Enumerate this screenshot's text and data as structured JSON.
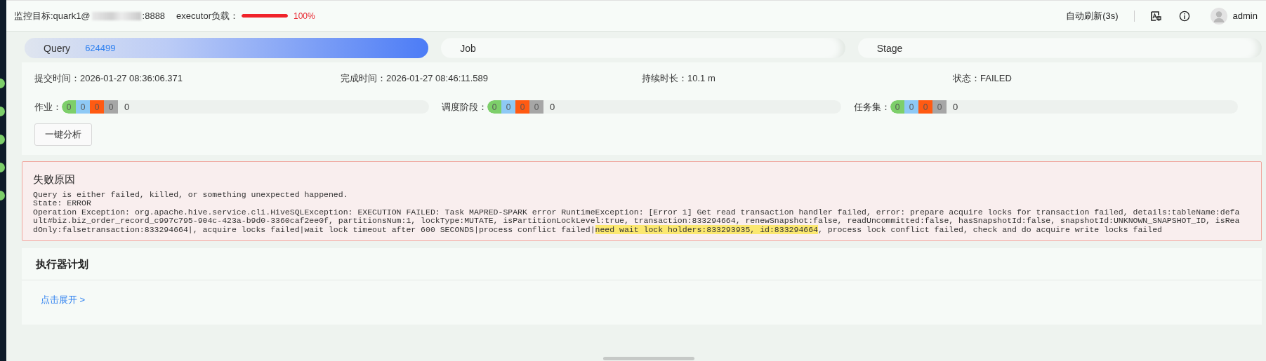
{
  "header": {
    "target_label": "监控目标:quark1@",
    "target_port": ":8888",
    "load_label": "executor负载：",
    "load": {
      "level": 1.0,
      "reading": "100%"
    },
    "refresh": "自动刷新(3s)",
    "user": "admin"
  },
  "tabs": [
    {
      "label": "Query",
      "count": "624499",
      "selected": true
    },
    {
      "label": "Job",
      "selected": false
    },
    {
      "label": "Stage",
      "selected": false
    }
  ],
  "summary": {
    "fields": [
      {
        "label": "提交时间：",
        "value": "2026-01-27 08:36:06.371"
      },
      {
        "label": "完成时间：",
        "value": "2026-01-27 08:46:11.589"
      },
      {
        "label": "持续时长：",
        "value": "10.1 m"
      },
      {
        "label": "状态：",
        "value": "FAILED"
      }
    ],
    "counters": [
      {
        "label": "作业：",
        "segments": [
          {
            "value": "0",
            "color": "#7dcf6a"
          },
          {
            "value": "0",
            "color": "#8ec9f5"
          },
          {
            "value": "0",
            "color": "#ff5a12"
          },
          {
            "value": "0",
            "color": "#a6a6a6"
          }
        ],
        "total": "0"
      },
      {
        "label": "调度阶段：",
        "segments": [
          {
            "value": "0",
            "color": "#7dcf6a"
          },
          {
            "value": "0",
            "color": "#8ec9f5"
          },
          {
            "value": "0",
            "color": "#ff5a12"
          },
          {
            "value": "0",
            "color": "#a6a6a6"
          }
        ],
        "total": "0"
      },
      {
        "label": "任务集：",
        "segments": [
          {
            "value": "0",
            "color": "#7dcf6a"
          },
          {
            "value": "0",
            "color": "#8ec9f5"
          },
          {
            "value": "0",
            "color": "#ff5a12"
          },
          {
            "value": "0",
            "color": "#a6a6a6"
          }
        ],
        "total": "0"
      }
    ],
    "analyze_button": "一键分析"
  },
  "failure": {
    "title": "失败原因",
    "lines": [
      "Query is either failed, killed, or something unexpected happened.",
      "State: ERROR"
    ],
    "detail_before": "Operation Exception: org.apache.hive.service.cli.HiveSQLException: EXECUTION FAILED: Task MAPRED-SPARK error RuntimeException: [Error 1] Get read transaction handler failed, error: prepare acquire locks for transaction failed, details:tableName:default#biz.biz_order_record_c997c795-904c-423a-b9d0-3360caf2ee0f, partitionsNum:1, lockType:MUTATE, isPartitionLockLevel:true, transaction:833294664, renewSnapshot:false, readUncommitted:false, hasSnapshotId:false, snapshotId:UNKNOWN_SNAPSHOT_ID, isReadOnly:falsetransaction:833294664|, acquire locks failed|wait lock timeout after 600 SECONDS|process conflict failed|",
    "highlight": "need wait lock holders:833293935, id:833294664",
    "detail_after": ", process lock conflict failed, check and do acquire write locks failed"
  },
  "plan": {
    "title": "执行器计划",
    "expand_link": "点击展开 >"
  }
}
